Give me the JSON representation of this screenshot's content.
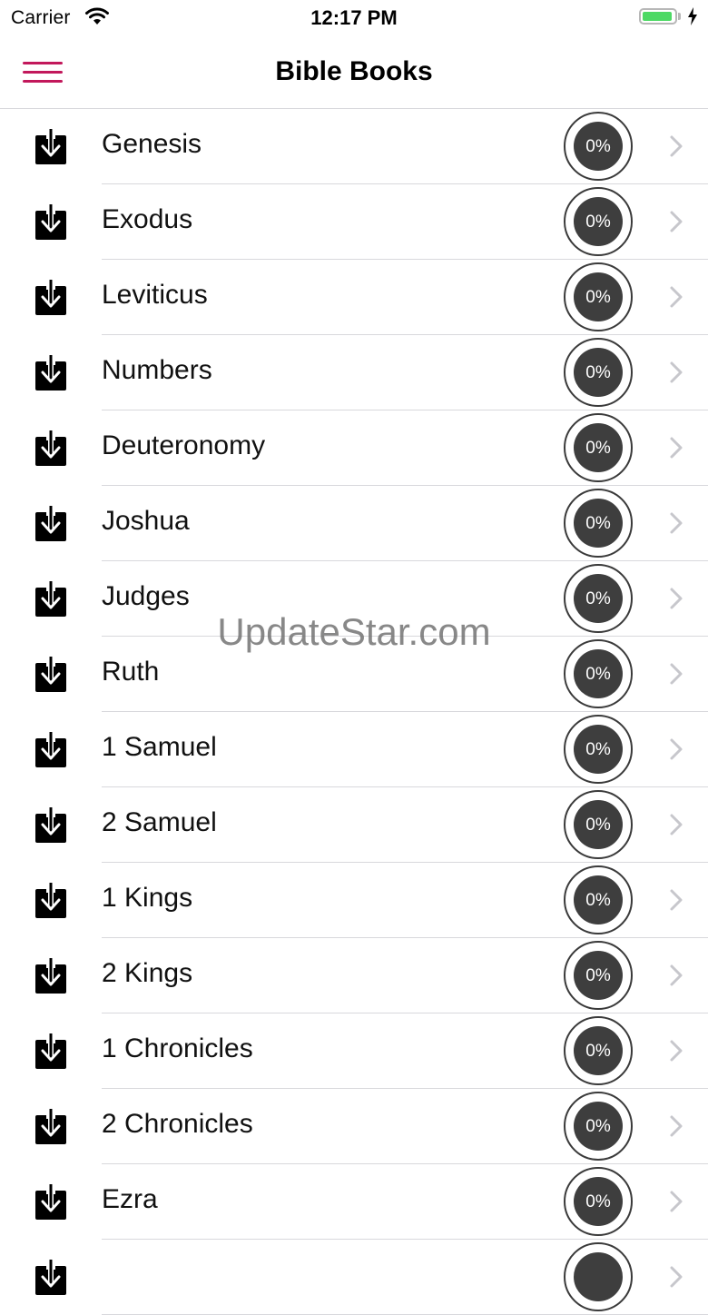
{
  "status": {
    "carrier": "Carrier",
    "time": "12:17 PM",
    "battery_level": 0.95
  },
  "nav": {
    "title": "Bible Books",
    "menu_icon": "hamburger-menu-icon"
  },
  "colors": {
    "accent": "#c2185b",
    "battery": "#4cd964",
    "progress_fill": "#3e3e3e"
  },
  "books": [
    {
      "name": "Genesis",
      "progress": "0%"
    },
    {
      "name": "Exodus",
      "progress": "0%"
    },
    {
      "name": "Leviticus",
      "progress": "0%"
    },
    {
      "name": "Numbers",
      "progress": "0%"
    },
    {
      "name": "Deuteronomy",
      "progress": "0%"
    },
    {
      "name": "Joshua",
      "progress": "0%"
    },
    {
      "name": "Judges",
      "progress": "0%"
    },
    {
      "name": "Ruth",
      "progress": "0%"
    },
    {
      "name": "1 Samuel",
      "progress": "0%"
    },
    {
      "name": "2 Samuel",
      "progress": "0%"
    },
    {
      "name": "1 Kings",
      "progress": "0%"
    },
    {
      "name": "2 Kings",
      "progress": "0%"
    },
    {
      "name": "1 Chronicles",
      "progress": "0%"
    },
    {
      "name": "2 Chronicles",
      "progress": "0%"
    },
    {
      "name": "Ezra",
      "progress": "0%"
    },
    {
      "name": "",
      "progress": ""
    }
  ],
  "watermark": "UpdateStar.com"
}
